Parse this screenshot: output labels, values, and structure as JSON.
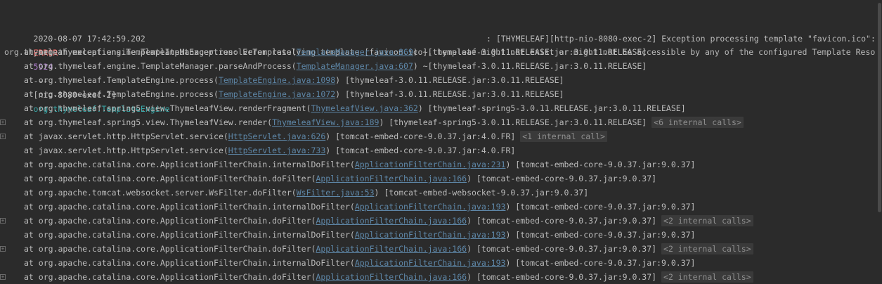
{
  "header": {
    "timestamp": "2020-08-07 17:42:59.202",
    "level": "ERROR",
    "pid": "5924",
    "separator": "---",
    "thread": "[nio-8080-exec-2]",
    "logger": "org.thymeleaf.TemplateEngine",
    "message": ": [THYMELEAF][http-nio-8080-exec-2] Exception processing template \"favicon.ico\": "
  },
  "exception": "org.thymeleaf.exceptions.TemplateInputException: Error resolving template [favicon.ico], template might not exist or might not be accessible by any of the configured Template Reso",
  "frames": [
    {
      "method": "at org.thymeleaf.engine.TemplateManager.resolveTemplate(",
      "link": "TemplateManager.java:869",
      "suffix": ") ~[thymeleaf-3.0.11.RELEASE.jar:3.0.11.RELEASE]",
      "badge": "",
      "fold": false
    },
    {
      "method": "at org.thymeleaf.engine.TemplateManager.parseAndProcess(",
      "link": "TemplateManager.java:607",
      "suffix": ") ~[thymeleaf-3.0.11.RELEASE.jar:3.0.11.RELEASE]",
      "badge": "",
      "fold": false
    },
    {
      "method": "at org.thymeleaf.TemplateEngine.process(",
      "link": "TemplateEngine.java:1098",
      "suffix": ") [thymeleaf-3.0.11.RELEASE.jar:3.0.11.RELEASE]",
      "badge": "",
      "fold": false
    },
    {
      "method": "at org.thymeleaf.TemplateEngine.process(",
      "link": "TemplateEngine.java:1072",
      "suffix": ") [thymeleaf-3.0.11.RELEASE.jar:3.0.11.RELEASE]",
      "badge": "",
      "fold": false
    },
    {
      "method": "at org.thymeleaf.spring5.view.ThymeleafView.renderFragment(",
      "link": "ThymeleafView.java:362",
      "suffix": ") [thymeleaf-spring5-3.0.11.RELEASE.jar:3.0.11.RELEASE]",
      "badge": "",
      "fold": false
    },
    {
      "method": "at org.thymeleaf.spring5.view.ThymeleafView.render(",
      "link": "ThymeleafView.java:189",
      "suffix": ") [thymeleaf-spring5-3.0.11.RELEASE.jar:3.0.11.RELEASE]",
      "badge": "<6 internal calls>",
      "fold": true
    },
    {
      "method": "at javax.servlet.http.HttpServlet.service(",
      "link": "HttpServlet.java:626",
      "suffix": ") [tomcat-embed-core-9.0.37.jar:4.0.FR]",
      "badge": "<1 internal call>",
      "fold": true
    },
    {
      "method": "at javax.servlet.http.HttpServlet.service(",
      "link": "HttpServlet.java:733",
      "suffix": ") [tomcat-embed-core-9.0.37.jar:4.0.FR]",
      "badge": "",
      "fold": false
    },
    {
      "method": "at org.apache.catalina.core.ApplicationFilterChain.internalDoFilter(",
      "link": "ApplicationFilterChain.java:231",
      "suffix": ") [tomcat-embed-core-9.0.37.jar:9.0.37]",
      "badge": "",
      "fold": false
    },
    {
      "method": "at org.apache.catalina.core.ApplicationFilterChain.doFilter(",
      "link": "ApplicationFilterChain.java:166",
      "suffix": ") [tomcat-embed-core-9.0.37.jar:9.0.37]",
      "badge": "",
      "fold": false
    },
    {
      "method": "at org.apache.tomcat.websocket.server.WsFilter.doFilter(",
      "link": "WsFilter.java:53",
      "suffix": ") [tomcat-embed-websocket-9.0.37.jar:9.0.37]",
      "badge": "",
      "fold": false
    },
    {
      "method": "at org.apache.catalina.core.ApplicationFilterChain.internalDoFilter(",
      "link": "ApplicationFilterChain.java:193",
      "suffix": ") [tomcat-embed-core-9.0.37.jar:9.0.37]",
      "badge": "",
      "fold": false
    },
    {
      "method": "at org.apache.catalina.core.ApplicationFilterChain.doFilter(",
      "link": "ApplicationFilterChain.java:166",
      "suffix": ") [tomcat-embed-core-9.0.37.jar:9.0.37]",
      "badge": "<2 internal calls>",
      "fold": true
    },
    {
      "method": "at org.apache.catalina.core.ApplicationFilterChain.internalDoFilter(",
      "link": "ApplicationFilterChain.java:193",
      "suffix": ") [tomcat-embed-core-9.0.37.jar:9.0.37]",
      "badge": "",
      "fold": false
    },
    {
      "method": "at org.apache.catalina.core.ApplicationFilterChain.doFilter(",
      "link": "ApplicationFilterChain.java:166",
      "suffix": ") [tomcat-embed-core-9.0.37.jar:9.0.37]",
      "badge": "<2 internal calls>",
      "fold": true
    },
    {
      "method": "at org.apache.catalina.core.ApplicationFilterChain.internalDoFilter(",
      "link": "ApplicationFilterChain.java:193",
      "suffix": ") [tomcat-embed-core-9.0.37.jar:9.0.37]",
      "badge": "",
      "fold": false
    },
    {
      "method": "at org.apache.catalina.core.ApplicationFilterChain.doFilter(",
      "link": "ApplicationFilterChain.java:166",
      "suffix": ") [tomcat-embed-core-9.0.37.jar:9.0.37]",
      "badge": "<2 internal calls>",
      "fold": true
    }
  ],
  "colors": {
    "background": "#2b2b2b",
    "text": "#bbbbbb",
    "error": "#ff6b68",
    "pid": "#b080d0",
    "logger": "#3aa9a9",
    "link": "#5e87a8"
  },
  "icons": {
    "fold": "fold-expand-icon"
  }
}
